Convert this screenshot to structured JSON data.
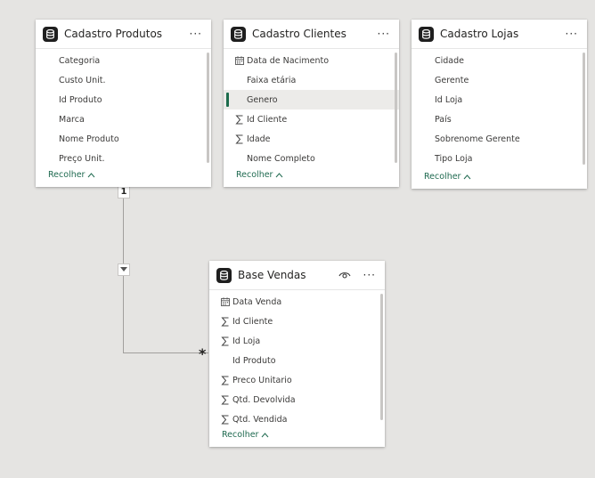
{
  "tables": {
    "produtos": {
      "title": "Cadastro Produtos",
      "fields": [
        {
          "label": "Categoria",
          "icon": ""
        },
        {
          "label": "Custo Unit.",
          "icon": ""
        },
        {
          "label": "Id Produto",
          "icon": ""
        },
        {
          "label": "Marca",
          "icon": ""
        },
        {
          "label": "Nome Produto",
          "icon": ""
        },
        {
          "label": "Preço Unit.",
          "icon": ""
        }
      ],
      "collapse_label": "Recolher"
    },
    "clientes": {
      "title": "Cadastro Clientes",
      "fields": [
        {
          "label": "Data de Nacimento",
          "icon": "calendar-icon"
        },
        {
          "label": "Faixa etária",
          "icon": ""
        },
        {
          "label": "Genero",
          "icon": "",
          "selected": true
        },
        {
          "label": "Id Cliente",
          "icon": "sigma-icon"
        },
        {
          "label": "Idade",
          "icon": "sigma-icon"
        },
        {
          "label": "Nome Completo",
          "icon": ""
        }
      ],
      "collapse_label": "Recolher"
    },
    "lojas": {
      "title": "Cadastro Lojas",
      "fields": [
        {
          "label": "Cidade",
          "icon": ""
        },
        {
          "label": "Gerente",
          "icon": ""
        },
        {
          "label": "Id Loja",
          "icon": ""
        },
        {
          "label": "País",
          "icon": ""
        },
        {
          "label": "Sobrenome Gerente",
          "icon": ""
        },
        {
          "label": "Tipo Loja",
          "icon": ""
        }
      ],
      "collapse_label": "Recolher"
    },
    "vendas": {
      "title": "Base Vendas",
      "fields": [
        {
          "label": "Data Venda",
          "icon": "calendar-icon"
        },
        {
          "label": "Id Cliente",
          "icon": "sigma-icon"
        },
        {
          "label": "Id Loja",
          "icon": "sigma-icon"
        },
        {
          "label": "Id Produto",
          "icon": ""
        },
        {
          "label": "Preco Unitario",
          "icon": "sigma-icon"
        },
        {
          "label": "Qtd. Devolvida",
          "icon": "sigma-icon"
        },
        {
          "label": "Qtd. Vendida",
          "icon": "sigma-icon"
        }
      ],
      "collapse_label": "Recolher"
    }
  },
  "relationship": {
    "one_side": "1",
    "many_side": "*"
  },
  "menu_glyph": "···",
  "colors": {
    "canvas": "#e5e4e2",
    "accent": "#1c6b4c",
    "link": "#1f6a50"
  }
}
